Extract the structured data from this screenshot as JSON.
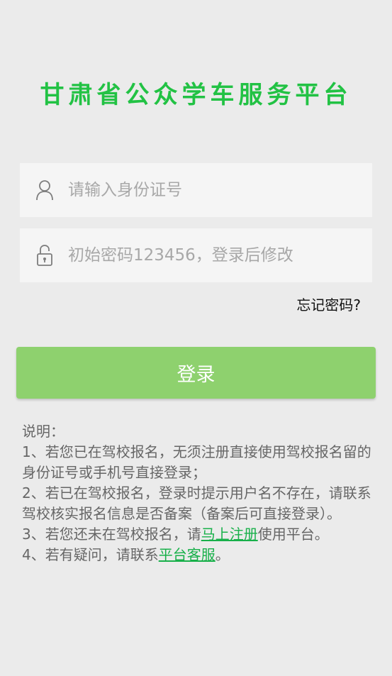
{
  "app_title": "甘肃省公众学车服务平台",
  "id_input": {
    "placeholder": "请输入身份证号",
    "value": "",
    "icon": "user-icon"
  },
  "password_input": {
    "placeholder": "初始密码123456，登录后修改",
    "value": "",
    "icon": "lock-icon"
  },
  "forgot_password": "忘记密码?",
  "login_button": "登录",
  "colors": {
    "title": "#22c244",
    "button": "#8ed16e",
    "link": "#18b04a",
    "background": "#ebebeb"
  },
  "notes": {
    "heading": "说明：",
    "line1": "1、若您已在驾校报名，无须注册直接使用驾校报名留的身份证号或手机号直接登录；",
    "line2": "2、若已在驾校报名，登录时提示用户名不存在，请联系驾校核实报名信息是否备案（备案后可直接登录）。",
    "line3_prefix": "3、若您还未在驾校报名，请",
    "line3_link": "马上注册",
    "line3_suffix": "使用平台。",
    "line4_prefix": "4、若有疑问，请联系",
    "line4_link": "平台客服",
    "line4_suffix": "。"
  }
}
